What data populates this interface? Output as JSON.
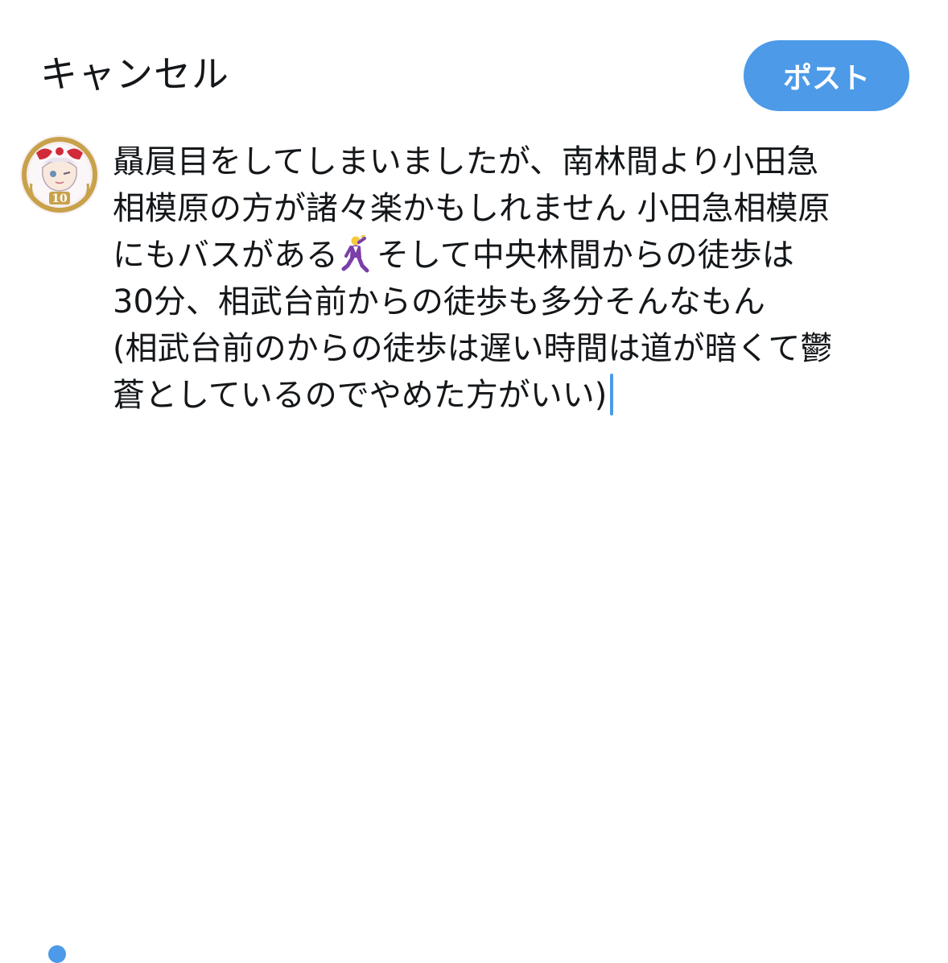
{
  "header": {
    "cancel_label": "キャンセル",
    "post_label": "ポスト"
  },
  "avatar": {
    "badge_text": "10"
  },
  "compose": {
    "line1": "贔屓目をしてしまいましたが、南林間より小田急",
    "line2": "相模原の方が諸々楽かもしれません 小田急相模原",
    "line3_before_emoji": "にもバスがある",
    "emoji": "man-dancing-emoji",
    "line3_after_emoji": "そして中央林間からの徒歩は",
    "line4": "30分、相武台前からの徒歩も多分そんなもん",
    "line5": "(相武台前のからの徒歩は遅い時間は道が暗くて鬱",
    "line6": "蒼としているのでやめた方がいい)"
  },
  "colors": {
    "accent": "#4c9ae8",
    "text": "#14171a",
    "background": "#ffffff"
  }
}
